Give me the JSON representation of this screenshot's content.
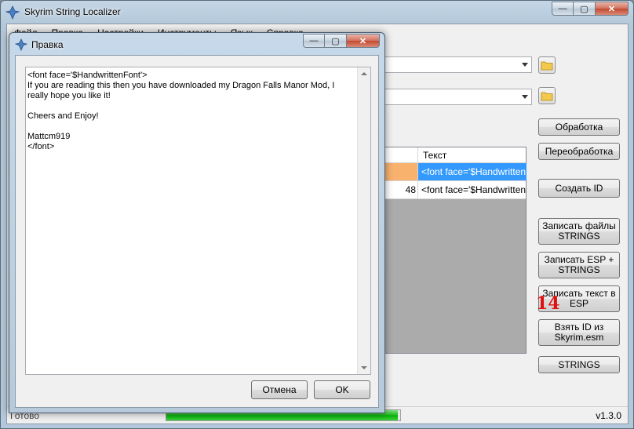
{
  "app": {
    "title": "Skyrim String Localizer",
    "version": "v1.3.0",
    "status": "Готово"
  },
  "menu": [
    "Файл",
    "Правка",
    "Настройки",
    "Инструменты",
    "Язык",
    "Справка"
  ],
  "side_buttons": [
    "Обработка",
    "Переобработка",
    "Создать ID",
    "Записать файлы STRINGS",
    "Записать ESP + STRINGS",
    "Записать текст в ESP",
    "Взять ID из Skyrim.esm",
    "STRINGS"
  ],
  "grid": {
    "header_text": "Текст",
    "rows": [
      {
        "id": "",
        "text": "<font face='$HandwrittenF...",
        "selected": true
      },
      {
        "id": "48",
        "text": "<font face='$HandwrittenF...",
        "selected": false
      }
    ]
  },
  "progress": {
    "fraction": 0.99
  },
  "annotation_number": "14",
  "dialog": {
    "title": "Правка",
    "text": "<font face='$HandwrittenFont'>\nIf you are reading this then you have downloaded my Dragon Falls Manor Mod, I really hope you like it!\n\nCheers and Enjoy!\n\nMattcm919\n</font>",
    "cancel_label": "Отмена",
    "ok_label": "OK"
  },
  "caption_buttons": {
    "minimize": "—",
    "maximize": "▢",
    "close": "✕"
  },
  "colors": {
    "selected_row": "#3399ff",
    "progress": "#06b006",
    "annotation": "#e01010"
  }
}
